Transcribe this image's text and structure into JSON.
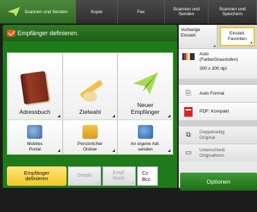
{
  "tabs": [
    {
      "label": "Scannen und Senden"
    },
    {
      "label": "Kopie"
    },
    {
      "label": "Fax"
    },
    {
      "label": "Scannen und Senden"
    },
    {
      "label": "Scannen und Speichern"
    }
  ],
  "header": {
    "title": "Empfänger definieren."
  },
  "main_buttons": [
    {
      "label": "Adressbuch",
      "icon": "address-book-icon"
    },
    {
      "label": "Zielwahl",
      "icon": "one-touch-pen-icon"
    },
    {
      "label": "Neuer Empfänger",
      "icon": "paper-plane-icon"
    }
  ],
  "sub_buttons": [
    {
      "label": "Mobiles Portal",
      "icon": "mobile-portal-icon"
    },
    {
      "label": "Persönlicher Ordner",
      "icon": "personal-folder-icon"
    },
    {
      "label": "An eigene Adr. senden",
      "icon": "send-to-myself-icon"
    }
  ],
  "bottom": {
    "define_recipient": "Empfänger definieren",
    "details": "Details",
    "delete_recipient": "Empf. lösch.",
    "cc_bcc": "Cc Bcc"
  },
  "right": {
    "previous_settings": "Vorherige Einstell.",
    "favorites": "Einstell. Favoriten",
    "color_mode": "Auto (Farbe/Graustufen)",
    "resolution": "300 x 300 dpi",
    "original_format": "Auto Format",
    "file_format": "PDF: Kompakt",
    "duplex": "Doppelseitig. Original",
    "mixed_originals": "Unterschiedl. Originalform.",
    "options": "Optionen"
  }
}
